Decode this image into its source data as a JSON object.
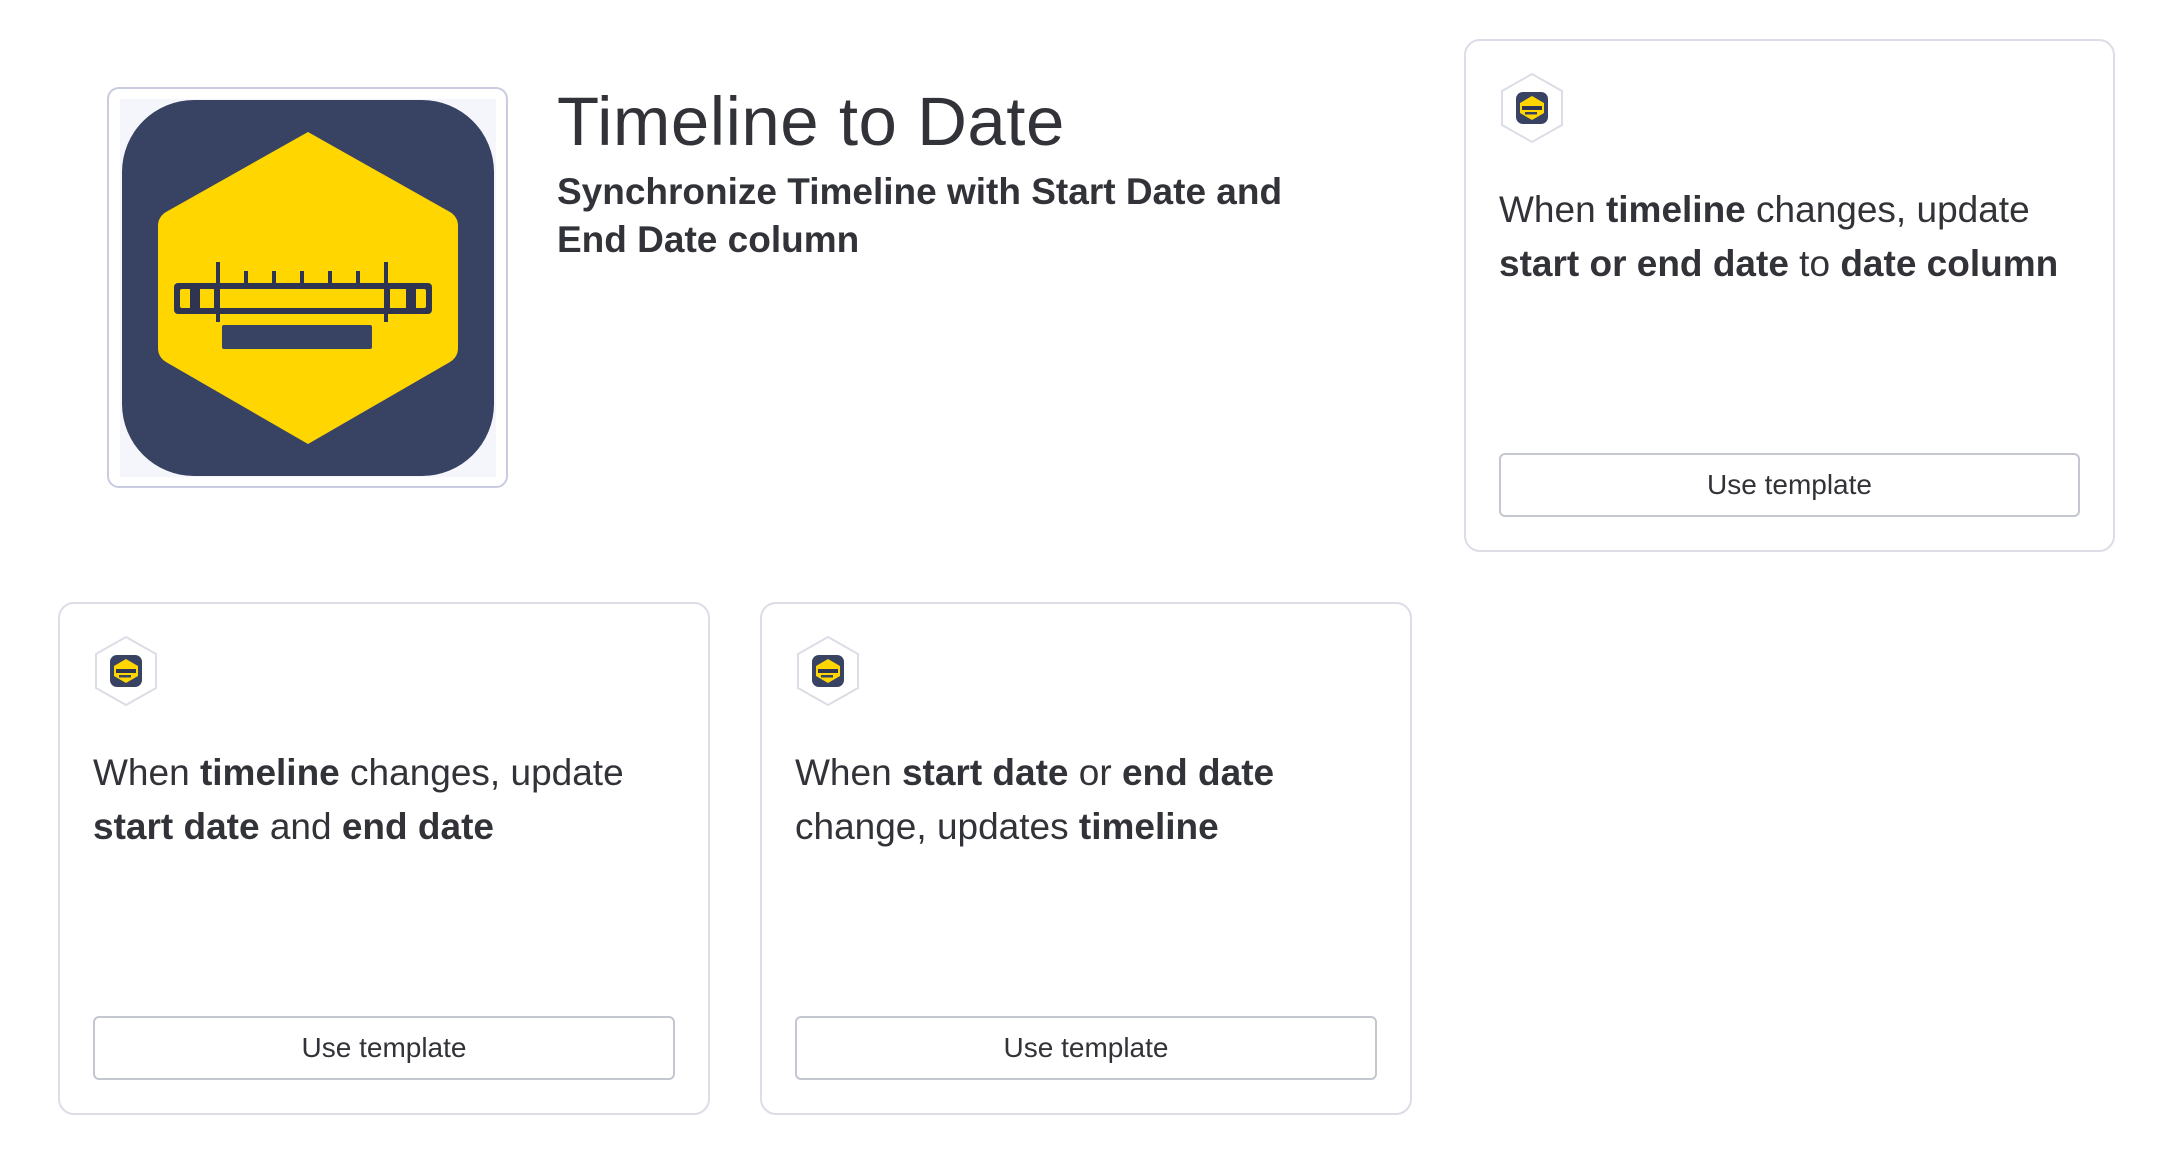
{
  "app": {
    "title": "Timeline to Date",
    "subtitle": "Synchronize Timeline with Start Date and End Date column",
    "logo_icon": "timeline-ruler-hexagon-icon",
    "colors": {
      "navy": "#384263",
      "yellow": "#ffd600"
    }
  },
  "templates": [
    {
      "parts": [
        {
          "t": "When ",
          "b": false
        },
        {
          "t": "timeline",
          "b": true
        },
        {
          "t": " changes, update ",
          "b": false
        },
        {
          "t": "start or end date",
          "b": true
        },
        {
          "t": " to ",
          "b": false
        },
        {
          "t": "date column",
          "b": true
        }
      ],
      "button": "Use template"
    },
    {
      "parts": [
        {
          "t": "When ",
          "b": false
        },
        {
          "t": "timeline",
          "b": true
        },
        {
          "t": " changes, update ",
          "b": false
        },
        {
          "t": "start date",
          "b": true
        },
        {
          "t": " and ",
          "b": false
        },
        {
          "t": "end date",
          "b": true
        }
      ],
      "button": "Use template"
    },
    {
      "parts": [
        {
          "t": "When ",
          "b": false
        },
        {
          "t": "start date",
          "b": true
        },
        {
          "t": " or ",
          "b": false
        },
        {
          "t": "end date",
          "b": true
        },
        {
          "t": " change, updates ",
          "b": false
        },
        {
          "t": "timeline",
          "b": true
        }
      ],
      "button": "Use template"
    }
  ]
}
